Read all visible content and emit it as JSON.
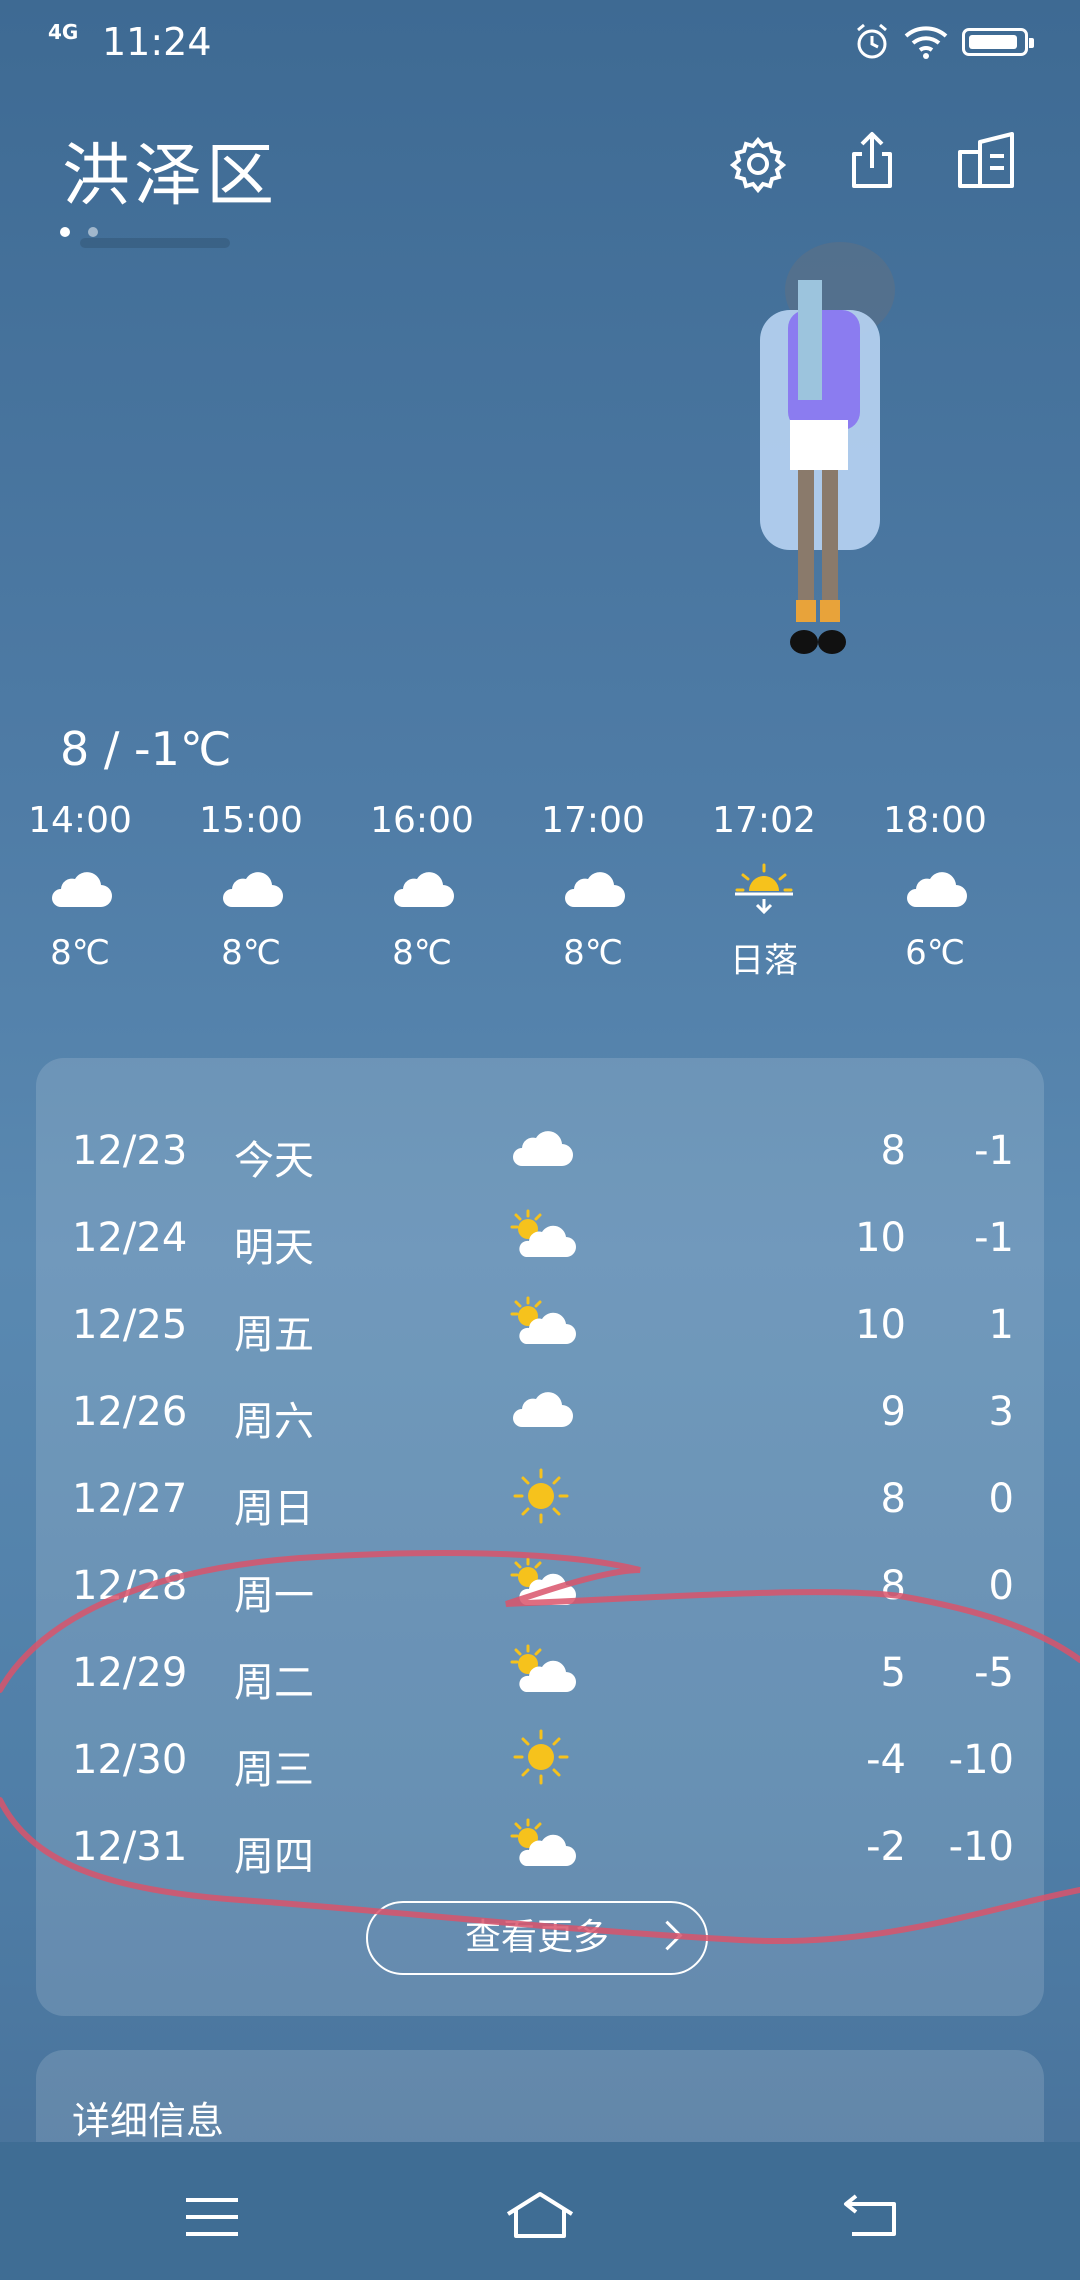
{
  "status_bar": {
    "network": "4G",
    "time": "11:24"
  },
  "header": {
    "city": "洪泽区"
  },
  "today_range": "8 / -1℃",
  "hourly": [
    {
      "time": "14:00",
      "icon": "cloud-icon",
      "value": "8℃"
    },
    {
      "time": "15:00",
      "icon": "cloud-icon",
      "value": "8℃"
    },
    {
      "time": "16:00",
      "icon": "cloud-icon",
      "value": "8℃"
    },
    {
      "time": "17:00",
      "icon": "cloud-icon",
      "value": "8℃"
    },
    {
      "time": "17:02",
      "icon": "sunset-icon",
      "value": "日落"
    },
    {
      "time": "18:00",
      "icon": "cloud-icon",
      "value": "6℃"
    }
  ],
  "daily": [
    {
      "date": "12/23",
      "weekday": "今天",
      "icon": "cloud-icon",
      "high": "8",
      "low": "-1"
    },
    {
      "date": "12/24",
      "weekday": "明天",
      "icon": "partly-cloudy-icon",
      "high": "10",
      "low": "-1"
    },
    {
      "date": "12/25",
      "weekday": "周五",
      "icon": "partly-cloudy-icon",
      "high": "10",
      "low": "1"
    },
    {
      "date": "12/26",
      "weekday": "周六",
      "icon": "cloud-icon",
      "high": "9",
      "low": "3"
    },
    {
      "date": "12/27",
      "weekday": "周日",
      "icon": "sun-icon",
      "high": "8",
      "low": "0"
    },
    {
      "date": "12/28",
      "weekday": "周一",
      "icon": "partly-cloudy-icon",
      "high": "8",
      "low": "0"
    },
    {
      "date": "12/29",
      "weekday": "周二",
      "icon": "partly-cloudy-icon",
      "high": "5",
      "low": "-5"
    },
    {
      "date": "12/30",
      "weekday": "周三",
      "icon": "sun-icon",
      "high": "-4",
      "low": "-10"
    },
    {
      "date": "12/31",
      "weekday": "周四",
      "icon": "partly-cloudy-icon",
      "high": "-2",
      "low": "-10"
    }
  ],
  "more_button": "查看更多",
  "details_title": "详细信息",
  "colors": {
    "background_top": "#3e6a93",
    "sun": "#f6c21c",
    "annotation": "#d9536b"
  }
}
